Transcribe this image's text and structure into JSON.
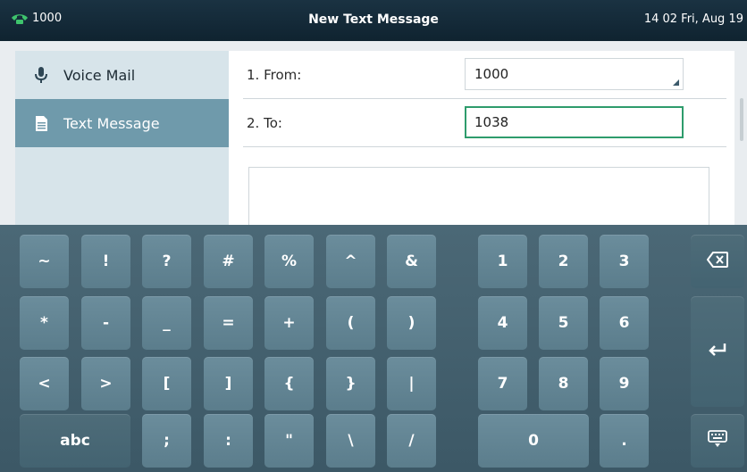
{
  "status_bar": {
    "line_number": "1000",
    "title": "New Text Message",
    "datetime": "14 02 Fri, Aug 19"
  },
  "sidebar": {
    "items": [
      {
        "label": "Voice Mail",
        "icon": "microphone-icon",
        "selected": false
      },
      {
        "label": "Text Message",
        "icon": "document-icon",
        "selected": true
      }
    ]
  },
  "form": {
    "from_label": "1. From:",
    "from_value": "1000",
    "to_label": "2. To:",
    "to_value": "1038",
    "message": ""
  },
  "keyboard": {
    "rows": [
      [
        "~",
        "!",
        "?",
        "#",
        "%",
        "^",
        "&"
      ],
      [
        "*",
        "-",
        "_",
        "=",
        "+",
        "(",
        ")"
      ],
      [
        "<",
        ">",
        "[",
        "]",
        "{",
        "}",
        "|"
      ],
      [
        "abc",
        ";",
        ":",
        "\"",
        "\\",
        "/"
      ]
    ],
    "numpad": [
      [
        "1",
        "2",
        "3"
      ],
      [
        "4",
        "5",
        "6"
      ],
      [
        "7",
        "8",
        "9"
      ],
      [
        "0",
        "."
      ]
    ],
    "special_keys": [
      "backspace-icon",
      "enter-icon",
      "hide-keyboard-icon"
    ]
  },
  "colors": {
    "status_bar": "#12283a",
    "sidebar": "#d7e4ea",
    "sidebar_selected": "#6f9aab",
    "active_field_border": "#2e9c6c",
    "key": "#628595",
    "keyboard_background": "#44606e"
  }
}
